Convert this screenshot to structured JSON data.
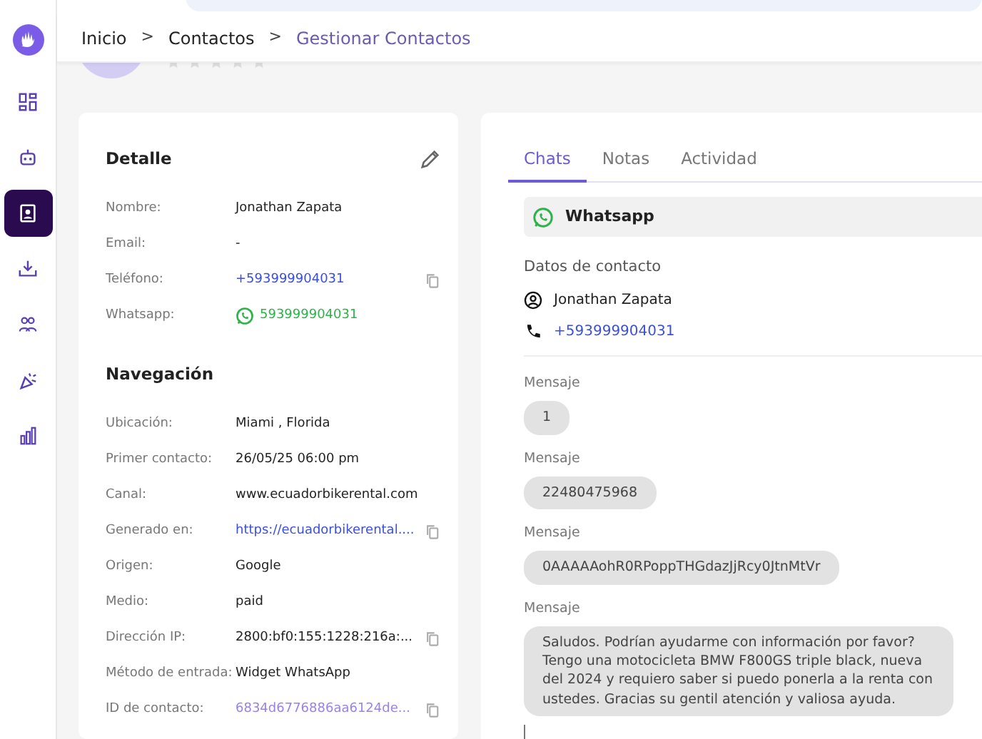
{
  "sidebar": {
    "items": [
      {
        "kind": "dashboard",
        "selected": false
      },
      {
        "kind": "robot",
        "selected": false
      },
      {
        "kind": "contacts",
        "selected": true
      },
      {
        "kind": "inbox",
        "selected": false
      },
      {
        "kind": "people",
        "selected": false
      },
      {
        "kind": "party",
        "selected": false
      },
      {
        "kind": "chart",
        "selected": false
      }
    ]
  },
  "breadcrumb": [
    {
      "label": "Inicio",
      "current": false
    },
    {
      "label": "Contactos",
      "current": false
    },
    {
      "label": "Gestionar Contactos",
      "current": true
    }
  ],
  "breadcrumb_separator": ">",
  "profile": {
    "stars": 0
  },
  "detail": {
    "title": "Detalle",
    "rows": [
      {
        "label": "Nombre:",
        "value": "Jonathan Zapata",
        "kind": "text",
        "copyable": false
      },
      {
        "label": "Email:",
        "value": "-",
        "kind": "text",
        "copyable": false
      },
      {
        "label": "Teléfono:",
        "value": "+593999904031",
        "kind": "link",
        "copyable": true
      },
      {
        "label": "Whatsapp:",
        "value": "593999904031",
        "kind": "whatsapp",
        "copyable": false
      }
    ]
  },
  "navigation": {
    "title": "Navegación",
    "rows": [
      {
        "label": "Ubicación:",
        "value": "Miami , Florida",
        "kind": "text",
        "copyable": false
      },
      {
        "label": "Primer contacto:",
        "value": "26/05/25 06:00 pm",
        "kind": "text",
        "copyable": false
      },
      {
        "label": "Canal:",
        "value": "www.ecuadorbikerental.com",
        "kind": "text",
        "copyable": false
      },
      {
        "label": "Generado en:",
        "value": "https://ecuadorbikerental....",
        "kind": "link",
        "copyable": true
      },
      {
        "label": "Origen:",
        "value": "Google",
        "kind": "text",
        "copyable": false
      },
      {
        "label": "Medio:",
        "value": "paid",
        "kind": "text",
        "copyable": false
      },
      {
        "label": "Dirección IP:",
        "value": "2800:bf0:155:1228:216a:...",
        "kind": "text",
        "copyable": true
      },
      {
        "label": "Método de entrada:",
        "value": "Widget WhatsApp",
        "kind": "text",
        "copyable": false
      },
      {
        "label": "ID de contacto:",
        "value": "6834d6776886aa6124de...",
        "kind": "id",
        "copyable": true
      }
    ]
  },
  "tabs": [
    {
      "label": "Chats",
      "selected": true
    },
    {
      "label": "Notas",
      "selected": false
    },
    {
      "label": "Actividad",
      "selected": false
    }
  ],
  "channel": {
    "name": "Whatsapp"
  },
  "contact_data": {
    "title": "Datos de contacto",
    "name": "Jonathan Zapata",
    "phone": "+593999904031"
  },
  "messages": [
    {
      "label": "Mensaje",
      "text": "1"
    },
    {
      "label": "Mensaje",
      "text": "22480475968"
    },
    {
      "label": "Mensaje",
      "text": "0AAAAAohR0RPoppTHGdazJjRcy0JtnMtVr"
    },
    {
      "label": "Mensaje",
      "text": "Saludos. Podrían ayudarme con información por favor? Tengo una motocicleta BMW F800GS triple black, nueva del 2024 y requiero saber si puedo ponerla a la renta con ustedes. Gracias su gentil atención y valiosa ayuda."
    }
  ]
}
